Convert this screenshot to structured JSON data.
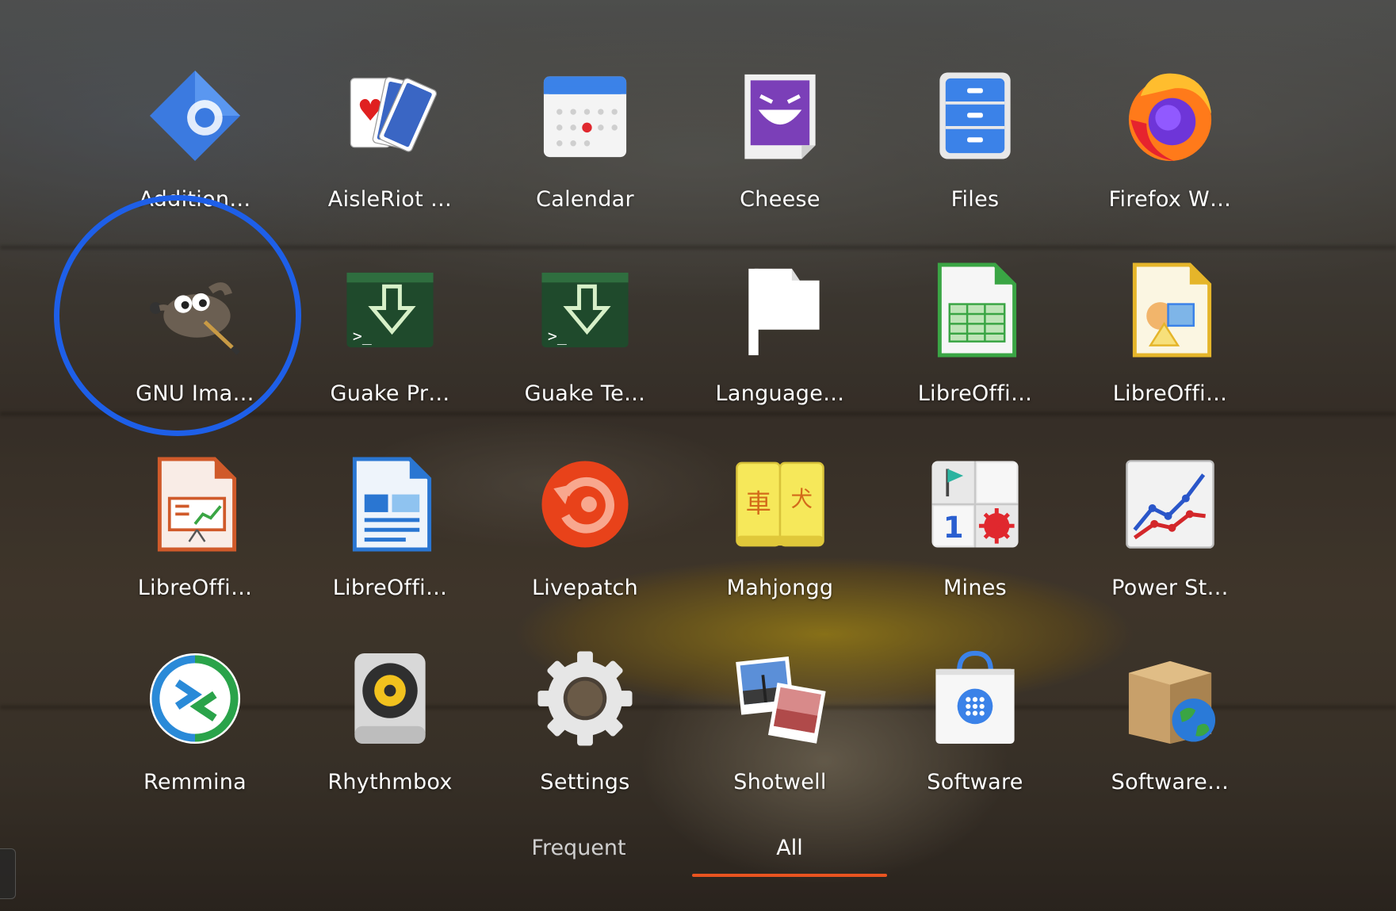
{
  "apps": [
    {
      "label": "Addition…",
      "icon": "additional-drivers-icon"
    },
    {
      "label": "AisleRiot …",
      "icon": "aisleriot-cards-icon"
    },
    {
      "label": "Calendar",
      "icon": "calendar-icon"
    },
    {
      "label": "Cheese",
      "icon": "cheese-icon"
    },
    {
      "label": "Files",
      "icon": "files-cabinet-icon"
    },
    {
      "label": "Firefox W…",
      "icon": "firefox-icon"
    },
    {
      "label": "GNU Ima…",
      "icon": "gimp-icon"
    },
    {
      "label": "Guake Pr…",
      "icon": "guake-icon"
    },
    {
      "label": "Guake Te…",
      "icon": "guake-icon"
    },
    {
      "label": "Language…",
      "icon": "language-flag-icon"
    },
    {
      "label": "LibreOffi…",
      "icon": "libreoffice-calc-icon"
    },
    {
      "label": "LibreOffi…",
      "icon": "libreoffice-draw-icon"
    },
    {
      "label": "LibreOffi…",
      "icon": "libreoffice-impress-icon"
    },
    {
      "label": "LibreOffi…",
      "icon": "libreoffice-writer-icon"
    },
    {
      "label": "Livepatch",
      "icon": "livepatch-icon"
    },
    {
      "label": "Mahjongg",
      "icon": "mahjongg-tiles-icon"
    },
    {
      "label": "Mines",
      "icon": "mines-icon"
    },
    {
      "label": "Power St…",
      "icon": "power-statistics-icon"
    },
    {
      "label": "Remmina",
      "icon": "remmina-icon"
    },
    {
      "label": "Rhythmbox",
      "icon": "rhythmbox-speaker-icon"
    },
    {
      "label": "Settings",
      "icon": "settings-gear-icon"
    },
    {
      "label": "Shotwell",
      "icon": "shotwell-photos-icon"
    },
    {
      "label": "Software",
      "icon": "software-bag-icon"
    },
    {
      "label": "Software…",
      "icon": "software-updater-icon"
    }
  ],
  "highlighted_app": "GNU Ima…",
  "tabs": {
    "frequent": "Frequent",
    "all": "All",
    "active": "All"
  },
  "colors": {
    "highlight_ring": "#1e5fe8",
    "active_tab_underline": "#e95420"
  }
}
